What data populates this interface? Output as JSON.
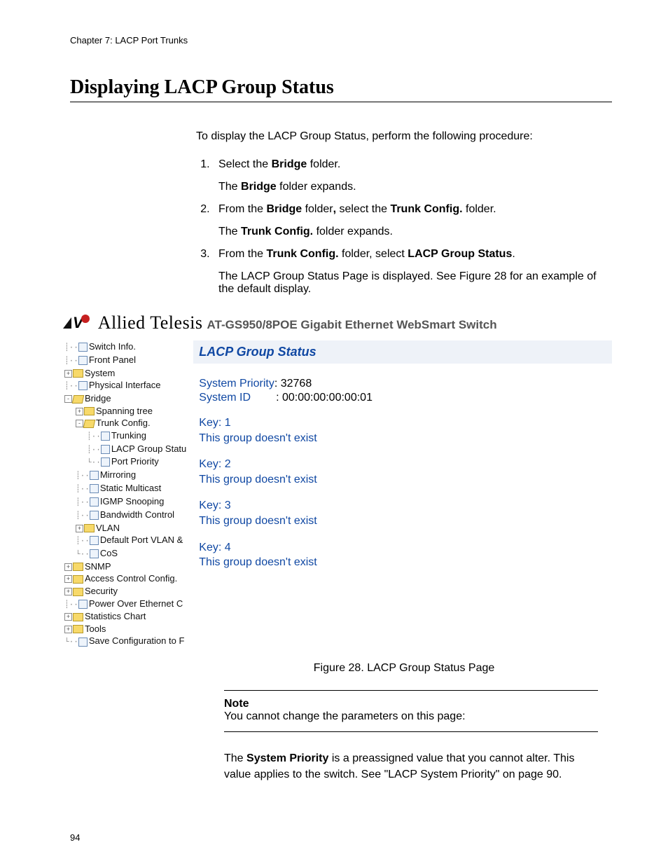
{
  "chapter": "Chapter 7: LACP Port Trunks",
  "title": "Displaying LACP Group Status",
  "intro": "To display the LACP Group Status, perform the following procedure:",
  "steps": {
    "s1a": "Select the ",
    "s1b": "Bridge",
    "s1c": " folder.",
    "s1sub_a": "The ",
    "s1sub_b": "Bridge",
    "s1sub_c": " folder expands.",
    "s2a": "From the ",
    "s2b": "Bridge",
    "s2c": " folder",
    "s2d": ",",
    "s2e": " select the ",
    "s2f": "Trunk Config.",
    "s2g": " folder.",
    "s2sub_a": "The ",
    "s2sub_b": "Trunk Config.",
    "s2sub_c": " folder expands.",
    "s3a": "From the ",
    "s3b": "Trunk Config.",
    "s3c": " folder, select ",
    "s3d": "LACP Group Status",
    "s3e": ".",
    "s3sub": "The LACP Group Status Page is displayed. See Figure 28 for an example of the default display."
  },
  "app": {
    "brand": "Allied Telesis",
    "product": "AT-GS950/8POE Gigabit Ethernet WebSmart Switch",
    "paneTitle": "LACP Group Status",
    "sysPriorityLabel": "System Priority",
    "sysPriorityValue": ": 32768",
    "sysIdLabel": "System ID",
    "sysIdValue": ": 00:00:00:00:00:01",
    "groups": [
      {
        "key": "Key: 1",
        "msg": "This group doesn't exist"
      },
      {
        "key": "Key: 2",
        "msg": "This group doesn't exist"
      },
      {
        "key": "Key: 3",
        "msg": "This group doesn't exist"
      },
      {
        "key": "Key: 4",
        "msg": "This group doesn't exist"
      }
    ],
    "tree": {
      "switchInfo": "Switch Info.",
      "frontPanel": "Front Panel",
      "system": "System",
      "physIf": "Physical Interface",
      "bridge": "Bridge",
      "spanning": "Spanning tree",
      "trunkCfg": "Trunk Config.",
      "trunking": "Trunking",
      "lacpGroup": "LACP Group Statu",
      "portPri": "Port Priority",
      "mirroring": "Mirroring",
      "staticMc": "Static Multicast",
      "igmp": "IGMP Snooping",
      "bw": "Bandwidth Control",
      "vlan": "VLAN",
      "defVlan": "Default Port VLAN &",
      "cos": "CoS",
      "snmp": "SNMP",
      "acl": "Access Control Config.",
      "security": "Security",
      "poe": "Power Over Ethernet C",
      "stats": "Statistics Chart",
      "tools": "Tools",
      "save": "Save Configuration to F"
    }
  },
  "figCaption": "Figure 28. LACP Group Status Page",
  "noteTitle": "Note",
  "noteBody": "You cannot change the parameters on this page:",
  "final_a": "The ",
  "final_b": "System Priority",
  "final_c": " is a preassigned value that you cannot alter. This value applies to the switch. See \"LACP System Priority\" on page 90.",
  "pageNum": "94"
}
